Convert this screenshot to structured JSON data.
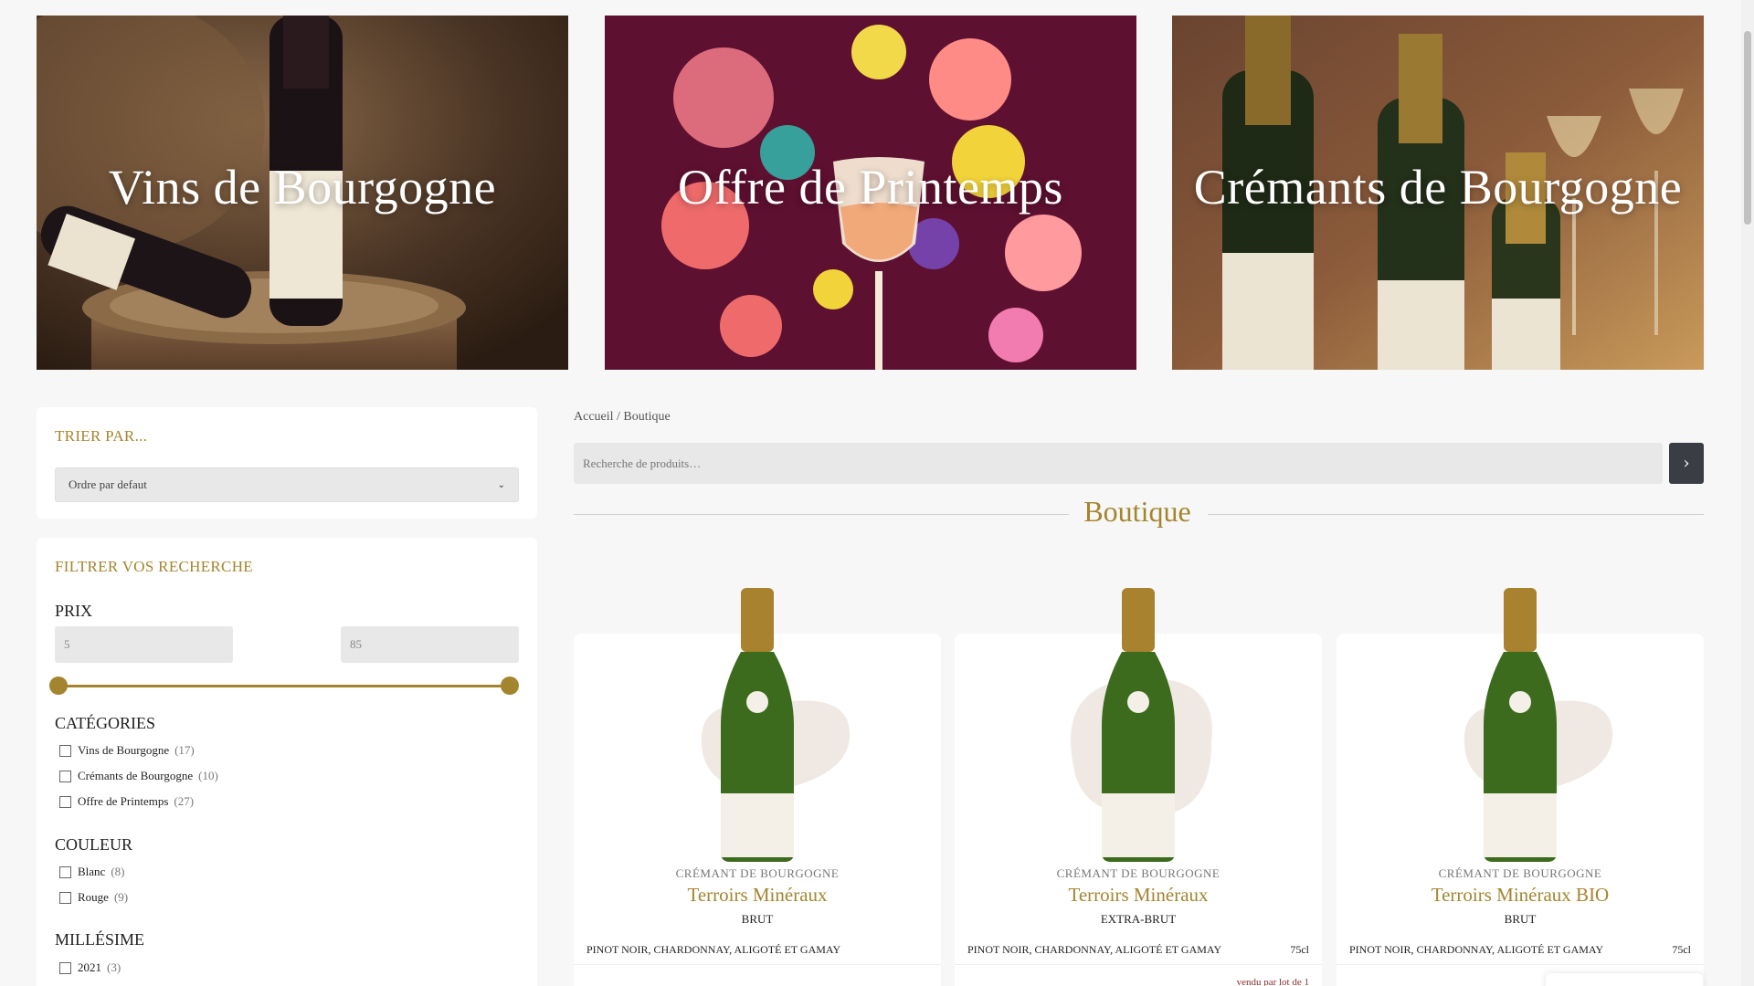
{
  "banners": [
    {
      "title": "Vins de Bourgogne"
    },
    {
      "title": "Offre de Printemps"
    },
    {
      "title": "Crémants de Bourgogne"
    }
  ],
  "sort": {
    "heading": "TRIER PAR...",
    "selected": "Ordre par defaut"
  },
  "filter": {
    "heading": "FILTRER VOS RECHERCHE",
    "price": {
      "label": "PRIX",
      "min": "5",
      "max": "85"
    },
    "categories": {
      "label": "CATÉGORIES",
      "items": [
        {
          "label": "Vins de Bourgogne",
          "count": "(17)"
        },
        {
          "label": "Crémants de Bourgogne",
          "count": "(10)"
        },
        {
          "label": "Offre de Printemps",
          "count": "(27)"
        }
      ]
    },
    "colour": {
      "label": "COULEUR",
      "items": [
        {
          "label": "Blanc",
          "count": "(8)"
        },
        {
          "label": "Rouge",
          "count": "(9)"
        }
      ]
    },
    "vintage": {
      "label": "MILLÉSIME",
      "items": [
        {
          "label": "2021",
          "count": "(3)"
        }
      ]
    }
  },
  "breadcrumb": {
    "home": "Accueil",
    "separator": "/",
    "current": "Boutique"
  },
  "search": {
    "placeholder": "Recherche de produits…"
  },
  "shop_title": "Boutique",
  "products": [
    {
      "category": "CRÉMANT DE BOURGOGNE",
      "name": "Terroirs Minéraux",
      "type": "BRUT",
      "grapes": "PINOT NOIR, CHARDONNAY, ALIGOTÉ ET GAMAY",
      "volume": "",
      "lot": ""
    },
    {
      "category": "CRÉMANT DE BOURGOGNE",
      "name": "Terroirs Minéraux",
      "type": "EXTRA-BRUT",
      "grapes": "PINOT NOIR, CHARDONNAY, ALIGOTÉ ET GAMAY",
      "volume": "75cl",
      "lot": "vendu par lot de 1"
    },
    {
      "category": "CRÉMANT DE BOURGOGNE",
      "name": "Terroirs Minéraux BIO",
      "type": "BRUT",
      "grapes": "PINOT NOIR, CHARDONNAY, ALIGOTÉ ET GAMAY",
      "volume": "75cl",
      "lot": ""
    }
  ],
  "colors": {
    "accent": "#a4852f",
    "button": "#3a3d44",
    "background": "#f7f7f7"
  }
}
